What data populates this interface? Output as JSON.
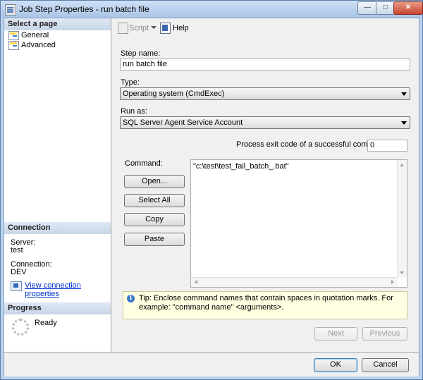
{
  "window": {
    "title": "Job Step Properties - run batch file"
  },
  "left": {
    "select_page_header": "Select a page",
    "pages": [
      "General",
      "Advanced"
    ],
    "connection_header": "Connection",
    "server_label": "Server:",
    "server_value": "test",
    "connection_label": "Connection:",
    "connection_value": "DEV",
    "view_connection_link": "View connection properties",
    "progress_header": "Progress",
    "progress_status": "Ready"
  },
  "toolbar": {
    "script_label": "Script",
    "help_label": "Help"
  },
  "form": {
    "step_name_label": "Step name:",
    "step_name_value": "run batch file",
    "type_label": "Type:",
    "type_value": "Operating system (CmdExec)",
    "run_as_label": "Run as:",
    "run_as_value": "SQL Server Agent Service Account",
    "exit_code_label": "Process exit code of a successful command:",
    "exit_code_value": "0",
    "command_label": "Command:",
    "command_value": "\"c:\\test\\test_fail_batch_.bat\"",
    "open_button": "Open...",
    "select_all_button": "Select All",
    "copy_button": "Copy",
    "paste_button": "Paste",
    "tip_text": "Tip: Enclose command names that contain spaces in quotation marks. For example: \"command name\" <arguments>.",
    "next_button": "Next",
    "previous_button": "Previous"
  },
  "footer": {
    "ok_button": "OK",
    "cancel_button": "Cancel"
  },
  "icons": [
    "app-icon",
    "page-icon",
    "script-icon",
    "help-icon",
    "connection-icon",
    "spinner-icon",
    "info-icon"
  ]
}
